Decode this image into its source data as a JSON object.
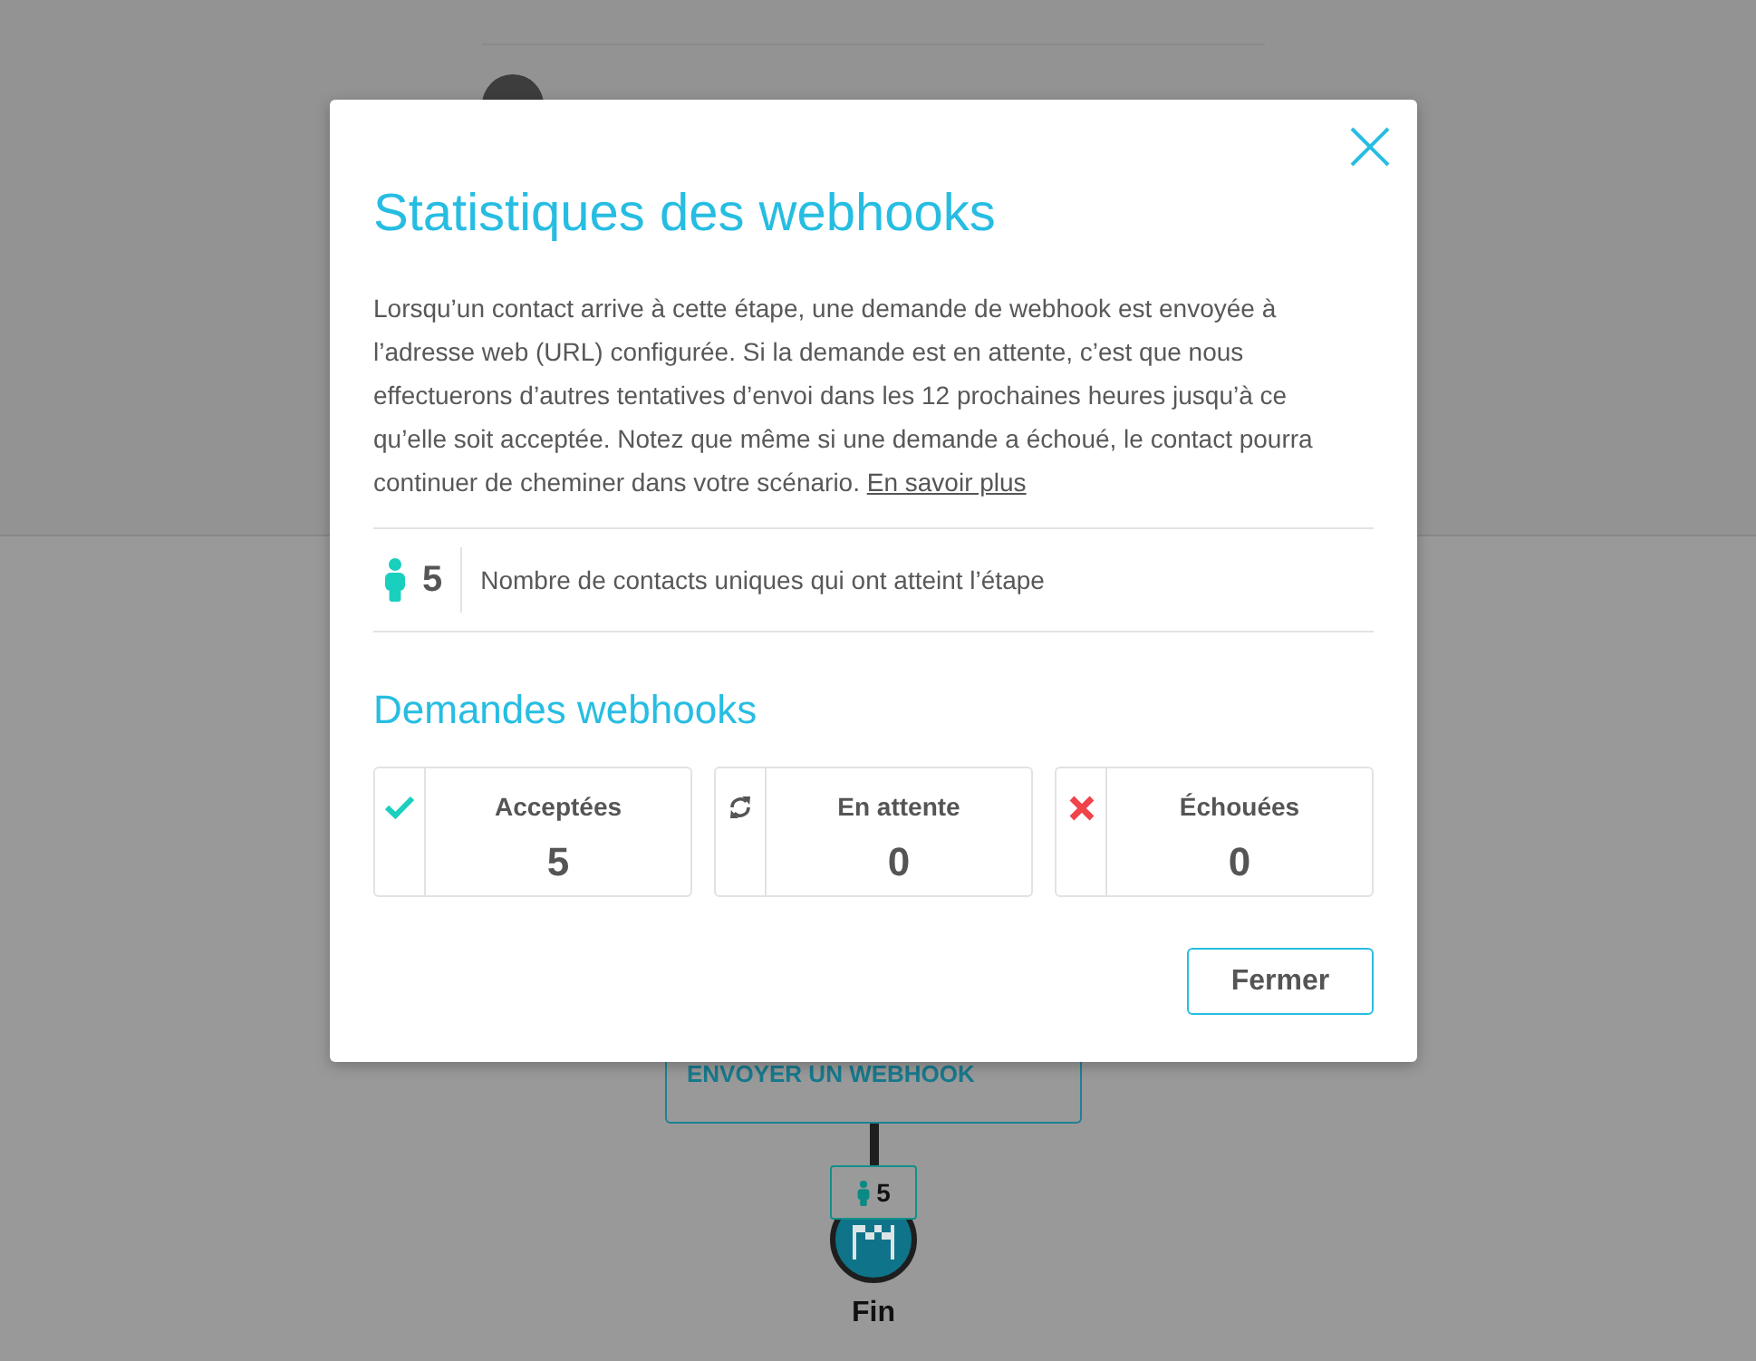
{
  "background": {
    "step_node": {
      "label": "ENVOYER UN WEBHOOK"
    },
    "step_badge": {
      "count": "5"
    },
    "end_node": {
      "label": "Fin"
    }
  },
  "modal": {
    "title": "Statistiques des webhooks",
    "description": "Lorsqu’un contact arrive à cette étape, une demande de webhook est envoyée à l’adresse web (URL) configurée. Si la demande est en attente, c’est que nous effectuerons d’autres tentatives d’envoi dans les 12 prochaines heures jusqu’à ce qu’elle soit acceptée. Notez que même si une demande a échoué, le contact pourra continuer de cheminer dans votre scénario.",
    "link": "En savoir plus",
    "contacts": {
      "count": "5",
      "label": "Nombre de contacts uniques qui ont atteint l’étape"
    },
    "requests_title": "Demandes webhooks",
    "requests": [
      {
        "kind": "accepted",
        "label": "Acceptées",
        "value": "5"
      },
      {
        "kind": "pending",
        "label": "En attente",
        "value": "0"
      },
      {
        "kind": "failed",
        "label": "Échouées",
        "value": "0"
      }
    ],
    "close_button": "Fermer"
  }
}
